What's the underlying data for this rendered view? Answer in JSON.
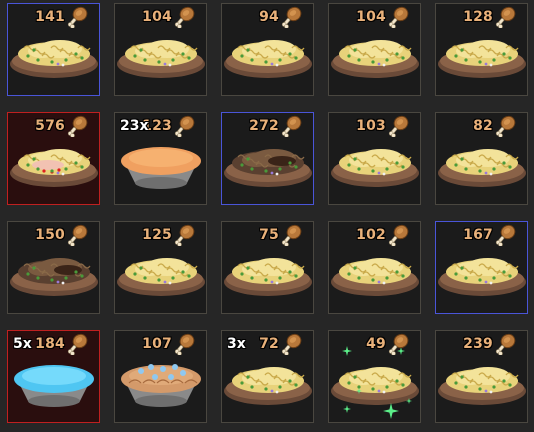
{
  "colors": {
    "accent_value": "#e9b17a",
    "border_default": "#4a4740",
    "border_blue": "#4a55d8",
    "border_red": "#c02020"
  },
  "slots": [
    {
      "value": "141",
      "qty": "",
      "food": "pasta",
      "border": "blue",
      "icon": "drumstick-icon"
    },
    {
      "value": "104",
      "qty": "",
      "food": "pasta",
      "border": "default",
      "icon": "drumstick-icon"
    },
    {
      "value": "94",
      "qty": "",
      "food": "pasta",
      "border": "default",
      "icon": "drumstick-icon"
    },
    {
      "value": "104",
      "qty": "",
      "food": "pasta",
      "border": "default",
      "icon": "drumstick-icon"
    },
    {
      "value": "128",
      "qty": "",
      "food": "pasta",
      "border": "default",
      "icon": "drumstick-icon"
    },
    {
      "value": "576",
      "qty": "",
      "food": "pasta-rich",
      "border": "red",
      "icon": "drumstick-icon"
    },
    {
      "value": "123",
      "qty": "23x",
      "food": "pie-orange",
      "border": "default",
      "icon": "drumstick-icon"
    },
    {
      "value": "272",
      "qty": "",
      "food": "pasta-dark",
      "border": "blue",
      "icon": "drumstick-icon"
    },
    {
      "value": "103",
      "qty": "",
      "food": "pasta",
      "border": "default",
      "icon": "drumstick-icon"
    },
    {
      "value": "82",
      "qty": "",
      "food": "pasta",
      "border": "default",
      "icon": "drumstick-icon"
    },
    {
      "value": "150",
      "qty": "",
      "food": "pasta-dark",
      "border": "default",
      "icon": "drumstick-icon"
    },
    {
      "value": "125",
      "qty": "",
      "food": "pasta",
      "border": "default",
      "icon": "drumstick-icon"
    },
    {
      "value": "75",
      "qty": "",
      "food": "pasta",
      "border": "default",
      "icon": "drumstick-icon"
    },
    {
      "value": "102",
      "qty": "",
      "food": "pasta",
      "border": "default",
      "icon": "drumstick-icon"
    },
    {
      "value": "167",
      "qty": "",
      "food": "pasta",
      "border": "blue",
      "icon": "drumstick-icon"
    },
    {
      "value": "184",
      "qty": "5x",
      "food": "pie-blue",
      "border": "red",
      "icon": "drumstick-icon"
    },
    {
      "value": "107",
      "qty": "",
      "food": "pie-crust",
      "border": "default",
      "icon": "drumstick-icon"
    },
    {
      "value": "72",
      "qty": "3x",
      "food": "pasta",
      "border": "default",
      "icon": "drumstick-icon"
    },
    {
      "value": "49",
      "qty": "",
      "food": "pasta-sparkle",
      "border": "default",
      "icon": "drumstick-icon"
    },
    {
      "value": "239",
      "qty": "",
      "food": "pasta",
      "border": "default",
      "icon": "drumstick-icon"
    }
  ]
}
